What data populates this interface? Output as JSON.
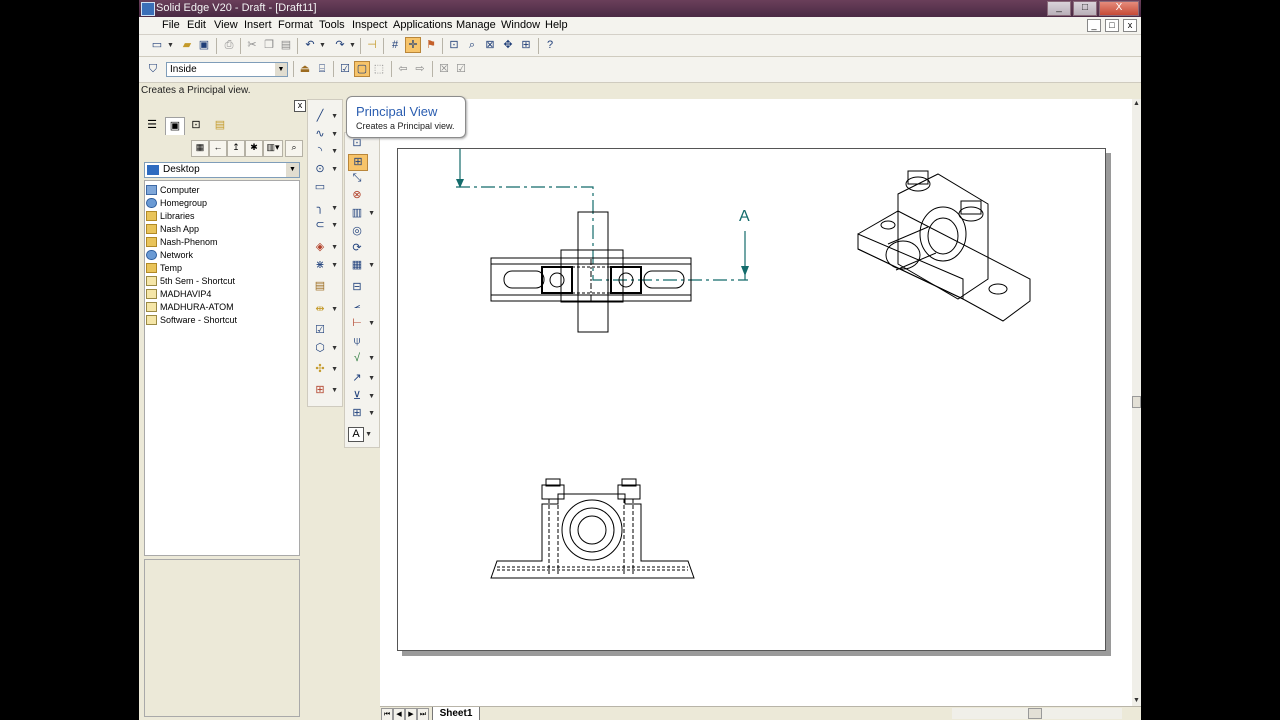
{
  "window": {
    "title": "Solid Edge V20 - Draft - [Draft11]",
    "buttons": [
      "_",
      "□",
      "X"
    ]
  },
  "menubar": {
    "items": [
      "File",
      "Edit",
      "View",
      "Insert",
      "Format",
      "Tools",
      "Inspect",
      "Applications",
      "Manage",
      "Window",
      "Help"
    ],
    "mdi_buttons": [
      "_",
      "□",
      "x"
    ]
  },
  "toolbar2": {
    "combo_value": "Inside"
  },
  "prompt": "Creates a Principal view.",
  "leftpane": {
    "close": "x",
    "location": "Desktop",
    "items": [
      "Computer",
      "Homegroup",
      "Libraries",
      "Nash App",
      "Nash-Phenom",
      "Network",
      "Temp",
      "5th Sem - Shortcut",
      "MADHAVIP4",
      "MADHURA-ATOM",
      "Software - Shortcut"
    ]
  },
  "tooltip": {
    "title": "Principal View",
    "description": "Creates a Principal view."
  },
  "drawing": {
    "section_label": "A"
  },
  "sheet_tabs": {
    "active": "Sheet1"
  }
}
